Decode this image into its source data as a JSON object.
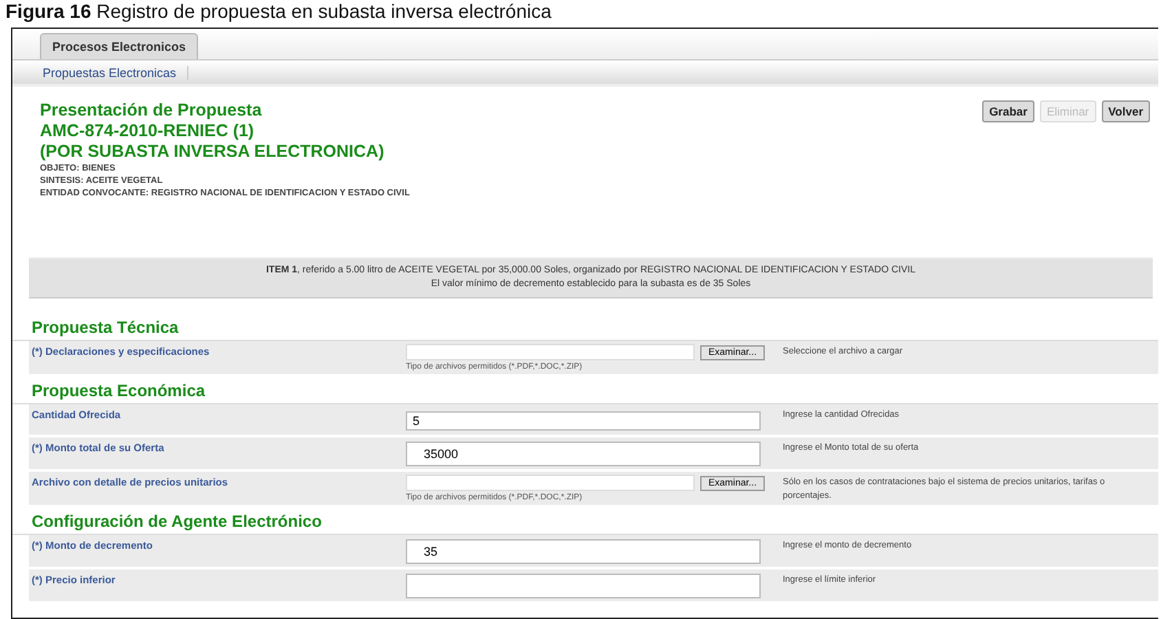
{
  "caption": "**Figura 16**  Registro de propuesta en subasta inversa electrónica",
  "tabs": [
    {
      "label": "Procesos Electronicos",
      "selected": true
    }
  ],
  "subtabs": [
    {
      "label": "Propuestas Electronicas",
      "selected": true
    }
  ],
  "header": {
    "titles": [
      "Presentación de Propuesta",
      "AMC-874-2010-RENIEC (1)",
      "(POR SUBASTA INVERSA ELECTRONICA)"
    ],
    "info": [
      "OBJETO: BIENES",
      "SINTESIS: ACEITE VEGETAL",
      "ENTIDAD CONVOCANTE: REGISTRO NACIONAL DE IDENTIFICACION Y ESTADO CIVIL"
    ]
  },
  "buttons": [
    {
      "label": "Grabar",
      "disabled": false
    },
    {
      "label": "Eliminar",
      "disabled": true
    },
    {
      "label": "Volver",
      "disabled": false
    }
  ],
  "item_banner": [
    "**ITEM 1**, referido a 5.00 litro de ACEITE VEGETAL  por 35,000.00 Soles, organizado por REGISTRO NACIONAL DE IDENTIFICACION Y ESTADO CIVIL",
    "El valor mínimo de decremento establecido para la subasta es de 35 Soles"
  ],
  "sections": [
    {
      "title": "Propuesta Técnica",
      "rows": [
        {
          "kind": "file",
          "label": "(*) Declaraciones y especificaciones",
          "button": "Examinar...",
          "file_types": "Tipo de archivos permitidos (*.PDF,*.DOC,*.ZIP)",
          "hint": "Seleccione el archivo a cargar"
        }
      ]
    },
    {
      "title": "Propuesta Económica",
      "rows": [
        {
          "kind": "text",
          "label": "Cantidad Ofrecida",
          "value": "5",
          "hint": "Ingrese la cantidad Ofrecidas"
        },
        {
          "kind": "text",
          "label": "(*) Monto total de su Oferta",
          "value": "35000",
          "hint": "Ingrese el Monto total de su oferta"
        },
        {
          "kind": "file",
          "label": "Archivo con detalle de precios unitarios",
          "button": "Examinar...",
          "file_types": "Tipo de archivos permitidos (*.PDF,*.DOC,*.ZIP)",
          "hint": "Sólo en los casos de contrataciones bajo el sistema de precios unitarios, tarifas o porcentajes."
        }
      ]
    },
    {
      "title": "Configuración de Agente Electrónico",
      "rows": [
        {
          "kind": "text",
          "label": "(*) Monto de decremento",
          "value": "35",
          "hint": "Ingrese el monto de decremento"
        },
        {
          "kind": "text",
          "label": "(*) Precio inferior",
          "hint": "Ingrese el límite inferior"
        }
      ]
    }
  ]
}
